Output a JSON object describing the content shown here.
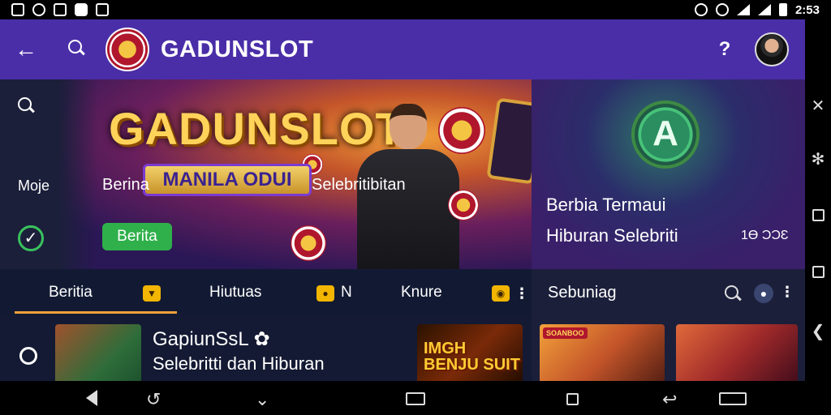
{
  "status_bar": {
    "time": "2:53"
  },
  "app_bar": {
    "brand": "GADUNSLOT",
    "help_glyph": "?"
  },
  "hero": {
    "title": "GADUNSLOT",
    "banner_text": "MANILA ODUI",
    "rail_more_label": "Moje",
    "tag_left": "Berina",
    "tag_right": "Selebritibitan",
    "button_label": "Berita"
  },
  "promo": {
    "badge_letter": "A",
    "title": "Berbia Termaui",
    "subtitle": "Hiburan Selebriti",
    "count": "1Ɵ ƆƆƐ"
  },
  "tabs": {
    "items": [
      {
        "label": "Beritia"
      },
      {
        "label": "Hiutuas"
      },
      {
        "label": "N"
      },
      {
        "label": "Knure"
      }
    ]
  },
  "side_panel": {
    "title": "Sebuniag"
  },
  "feed": {
    "title": "GapiunSsL",
    "subtitle": "Selebritti dan Hiburan",
    "thumb2_text": "IMGH BENJU SUIT"
  },
  "side_feed": {
    "badge": "SOANBOO"
  },
  "colors": {
    "app_bar": "#4a2ea8",
    "hero_accent": "#f2a13a",
    "brand_gold": "#ffd35a",
    "button_green": "#2fb04a",
    "tab_badge": "#f2b600",
    "panel_dark": "#1b1f3a"
  },
  "icons": {
    "status_left": [
      "sim-icon",
      "whatsapp-icon",
      "qr-icon",
      "video-icon",
      "battery-saver-icon"
    ],
    "status_right": [
      "alarm-icon",
      "dnd-icon",
      "wifi-icon",
      "signal-icon",
      "battery-icon"
    ]
  }
}
